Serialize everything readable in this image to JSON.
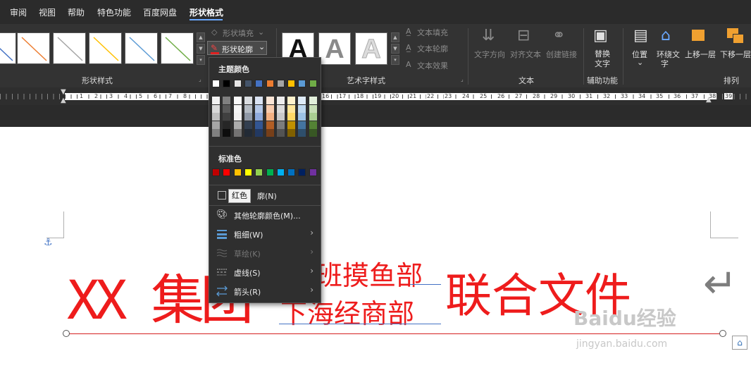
{
  "menubar": {
    "tabs": [
      "审阅",
      "视图",
      "帮助",
      "特色功能",
      "百度网盘",
      "形状格式"
    ],
    "active_tab": "形状格式"
  },
  "ribbon": {
    "shape_styles": {
      "group_label": "形状样式",
      "fill_label": "形状填充",
      "outline_label": "形状轮廓",
      "line_colors": [
        "#4472c4",
        "#ed7d31",
        "#a5a5a5",
        "#ffc000",
        "#5b9bd5",
        "#70ad47"
      ]
    },
    "art_text": {
      "group_label": "艺术字样式",
      "letter": "A",
      "text_fill": "文本填充",
      "text_outline": "文本轮廓",
      "text_effect": "文本效果"
    },
    "text_group": {
      "group_label": "文本",
      "direction": "文字方向",
      "align": "对齐文本",
      "link": "创建链接"
    },
    "aux_group": {
      "group_label": "辅助功能",
      "replace_line1": "替换",
      "replace_line2": "文字"
    },
    "arrange_group": {
      "group_label": "排列",
      "position": "位置",
      "wrap_line1": "环绕文",
      "wrap_line2": "字",
      "bring_forward": "上移一层",
      "send_backward": "下移一层"
    }
  },
  "ruler": {
    "numbers": [
      "1",
      "2",
      "3",
      "4",
      "5",
      "6",
      "7",
      "8",
      "16",
      "17",
      "18",
      "19",
      "20",
      "21",
      "22",
      "23",
      "24",
      "25",
      "26",
      "27",
      "28",
      "29",
      "30",
      "31",
      "32",
      "33",
      "34",
      "35",
      "36",
      "37",
      "38",
      "39"
    ]
  },
  "document": {
    "big_left": "XX 集团",
    "stack_top": "班摸鱼部",
    "stack_bottom": "下海经商部",
    "big_right": "联合文件",
    "return_mark": "↵",
    "watermark_logo": "Baidu经验",
    "watermark_url": "jingyan.baidu.com"
  },
  "dropdown": {
    "theme_colors_heading": "主题颜色",
    "theme_colors": [
      "#ffffff",
      "#000000",
      "#e7e6e6",
      "#44546a",
      "#4472c4",
      "#ed7d31",
      "#a5a5a5",
      "#ffc000",
      "#5b9bd5",
      "#70ad47"
    ],
    "standard_colors_heading": "标准色",
    "standard_colors": [
      "#c00000",
      "#ff0000",
      "#ffc000",
      "#ffff00",
      "#92d050",
      "#00b050",
      "#00b0f0",
      "#0070c0",
      "#002060",
      "#7030a0"
    ],
    "no_outline_tail": "廓(N)",
    "tooltip": "红色",
    "items": {
      "more_colors": "其他轮廓颜色(M)...",
      "weight": "粗细(W)",
      "sketch": "草绘(K)",
      "dashes": "虚线(S)",
      "arrows": "箭头(R)"
    }
  }
}
